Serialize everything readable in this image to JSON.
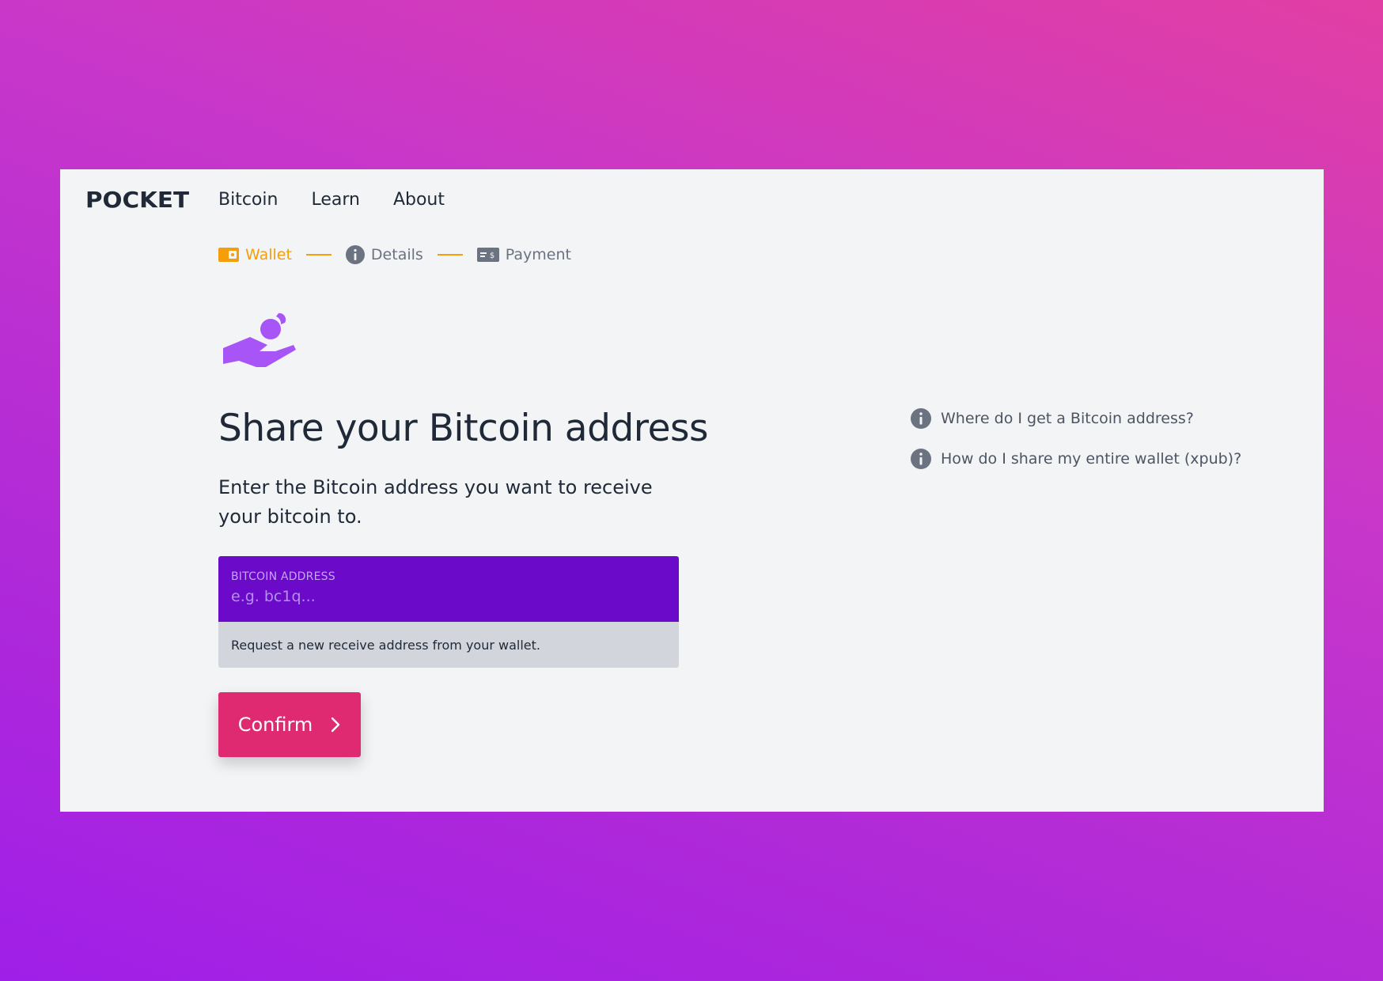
{
  "brand": {
    "logo_text": "POCKET"
  },
  "nav": {
    "items": [
      {
        "label": "Bitcoin"
      },
      {
        "label": "Learn"
      },
      {
        "label": "About"
      }
    ]
  },
  "steps": [
    {
      "label": "Wallet",
      "icon": "wallet-icon",
      "state": "active",
      "color": "#f59e0b"
    },
    {
      "label": "Details",
      "icon": "info-icon",
      "state": "upcoming"
    },
    {
      "label": "Payment",
      "icon": "payment-card-icon",
      "state": "upcoming"
    }
  ],
  "main": {
    "hero_icon": "hand-receiving-coin-icon",
    "title": "Share your Bitcoin address",
    "subtitle": "Enter the Bitcoin address you want to receive your bitcoin to.",
    "address_field": {
      "label": "BITCOIN ADDRESS",
      "value": "",
      "placeholder": "e.g. bc1q...",
      "help_text": "Request a new receive address from your wallet."
    },
    "confirm_button": {
      "label": "Confirm",
      "icon": "chevron-right-icon"
    }
  },
  "faq": {
    "items": [
      {
        "label": "Where do I get a Bitcoin address?",
        "icon": "info-icon"
      },
      {
        "label": "How do I share my entire wallet (xpub)?",
        "icon": "info-icon"
      }
    ]
  },
  "colors": {
    "accent_purple": "#6b0ac9",
    "confirm_pink": "#df2a72",
    "step_orange": "#f59e0b",
    "hero_purple": "#a855f7",
    "card_background": "#f3f4f6"
  }
}
